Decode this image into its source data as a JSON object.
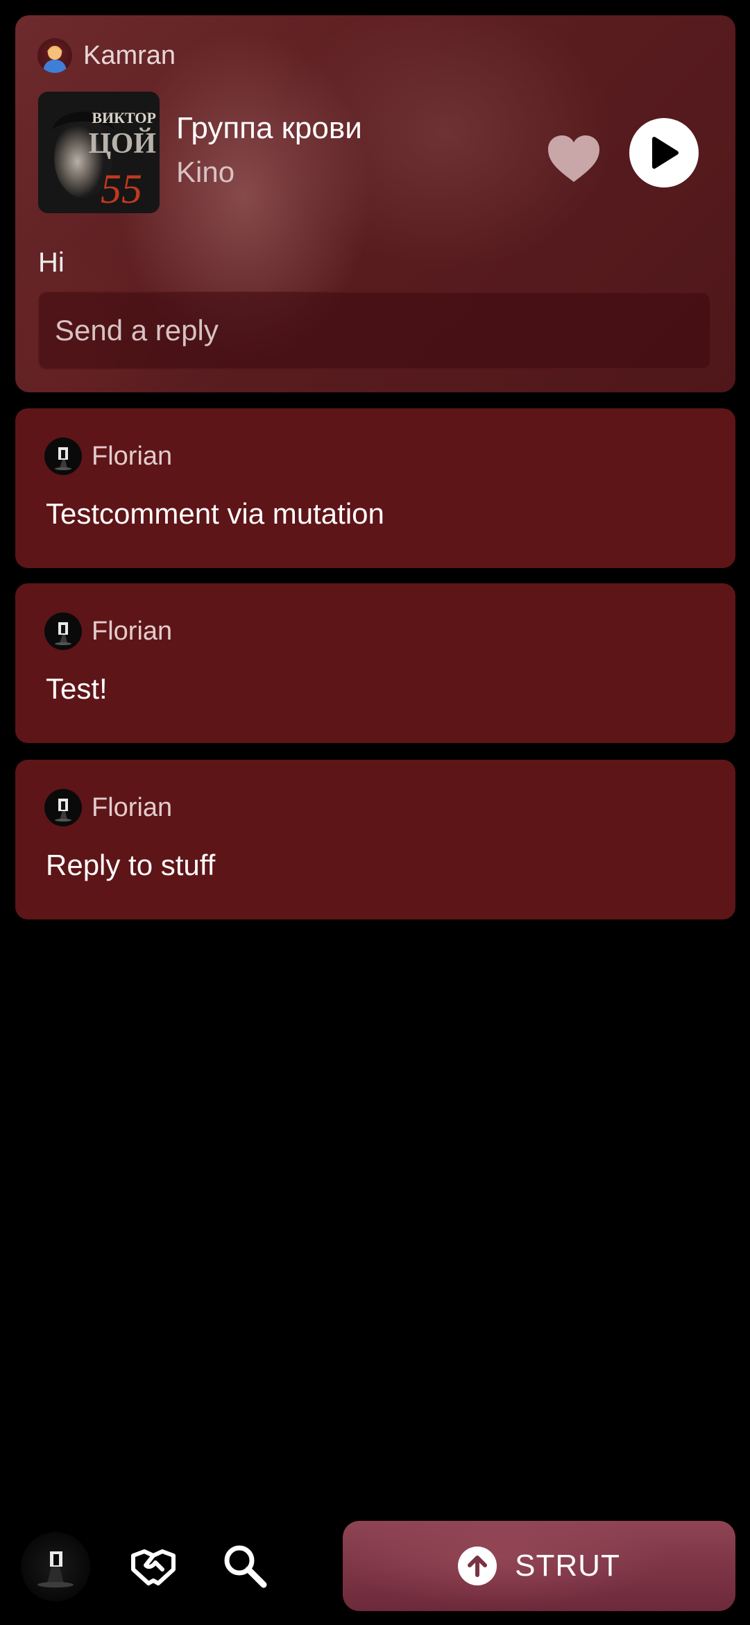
{
  "post": {
    "username": "Kamran",
    "avatar_icon": "user-avatar-icon",
    "track": {
      "title": "Группа крови",
      "artist": "Kino",
      "album_art_text_line1": "ВИКТОР",
      "album_art_text_line2": "ЦОЙ",
      "album_art_text_line3": "55"
    },
    "like_icon": "heart-icon",
    "play_icon": "play-icon",
    "message": "Hi",
    "reply_placeholder": "Send a reply"
  },
  "comments": [
    {
      "username": "Florian",
      "text": "Testcomment via mutation"
    },
    {
      "username": "Florian",
      "text": "Test!"
    },
    {
      "username": "Florian",
      "text": "Reply to stuff"
    }
  ],
  "bottom_bar": {
    "profile_icon": "profile-avatar",
    "friends_icon": "handshake-icon",
    "search_icon": "search-icon",
    "strut_icon": "arrow-up-circle-icon",
    "strut_label": "STRUT"
  },
  "colors": {
    "background": "#000000",
    "comment_card": "#5e1518",
    "post_card": "#5a1d20",
    "strut_button": "#7a3343",
    "like_heart": "#c9a7a8"
  }
}
